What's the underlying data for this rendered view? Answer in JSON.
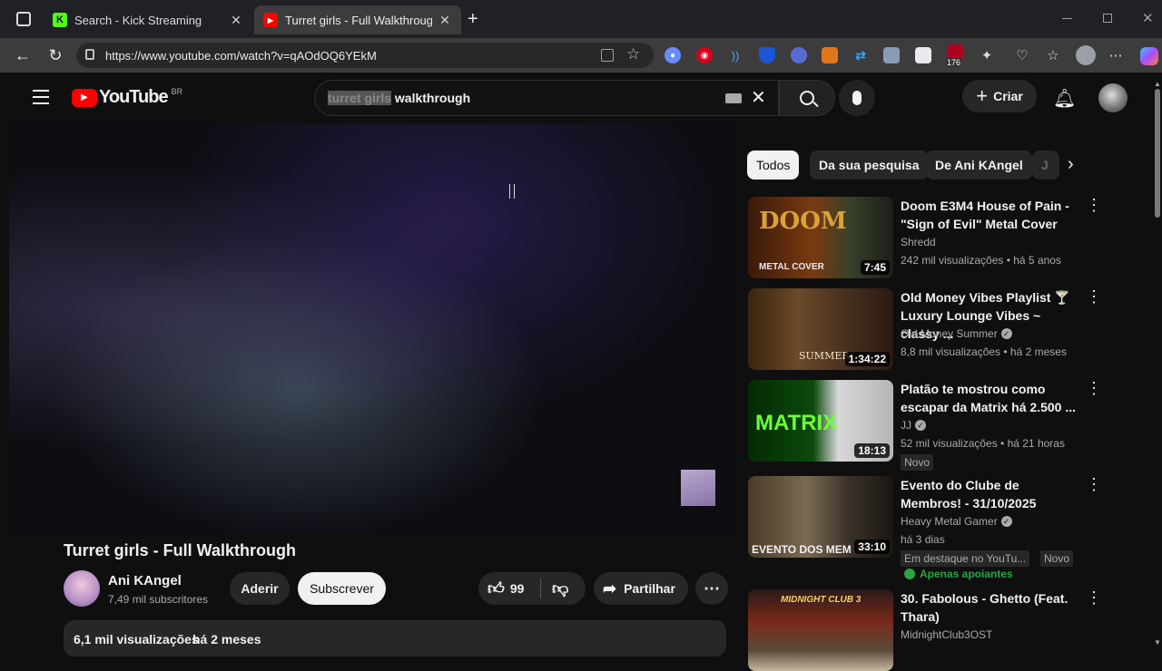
{
  "browser": {
    "tabs": [
      {
        "label": "Search - Kick Streaming",
        "favicon": "kick-icon"
      },
      {
        "label": "Turret girls - Full Walkthrough - YouTube",
        "favicon": "youtube-icon"
      }
    ],
    "url": "https://www.youtube.com/watch?v=qAOdOQ6YEkM",
    "ext_badge": "176"
  },
  "youtube": {
    "logo_text": "YouTube",
    "region": "BR",
    "search_highlight": "turret girls",
    "search_rest": " walkthrough",
    "create_label": "Criar"
  },
  "chips": [
    "Todos",
    "Da sua pesquisa",
    "De Ani KAngel",
    "J"
  ],
  "video": {
    "title": "Turret girls - Full Walkthrough",
    "channel": "Ani KAngel",
    "subscribers": "7,49 mil subscritores",
    "join_label": "Aderir",
    "subscribe_label": "Subscrever",
    "likes": "99",
    "share_label": "Partilhar",
    "views": "6,1 mil visualizações",
    "age": "há 2 meses"
  },
  "recommendations": [
    {
      "title": "Doom E3M4 House of Pain - \"Sign of Evil\" Metal Cover",
      "channel": "Shredd",
      "verified": false,
      "meta": "242 mil visualizações • há 5 anos",
      "duration": "7:45",
      "thumb_text": "DOOM",
      "thumb_sub": "METAL COVER"
    },
    {
      "title": "Old Money Vibes Playlist 🍸 Luxury Lounge Vibes ~ classy ...",
      "channel": "Old Money Summer",
      "verified": true,
      "meta": "8,8 mil visualizações • há 2 meses",
      "duration": "1:34:22",
      "thumb_text": "SUMMER"
    },
    {
      "title": "Platão te mostrou como escapar da Matrix há 2.500 ...",
      "channel": "JJ",
      "verified": true,
      "meta": "52 mil visualizações • há 21 horas",
      "duration": "18:13",
      "thumb_text": "MATRIX",
      "badge": "Novo"
    },
    {
      "title": "Evento do Clube de Membros! - 31/10/2025",
      "channel": "Heavy Metal Gamer",
      "verified": true,
      "meta": "há 3 dias",
      "duration": "33:10",
      "thumb_text": "EVENTO DOS MEM",
      "badge1": "Em destaque no YouTu...",
      "badge2": "Novo",
      "members": "Apenas apoiantes"
    },
    {
      "title": "30. Fabolous - Ghetto (Feat. Thara)",
      "channel": "MidnightClub3OST",
      "verified": false,
      "meta": "",
      "duration": "",
      "thumb_text": "MIDNIGHT CLUB 3"
    }
  ],
  "colors": {
    "youtube_red": "#ff0000",
    "kick_green": "#53fc18",
    "chip_bg": "#272727",
    "member_green": "#2ba640"
  }
}
